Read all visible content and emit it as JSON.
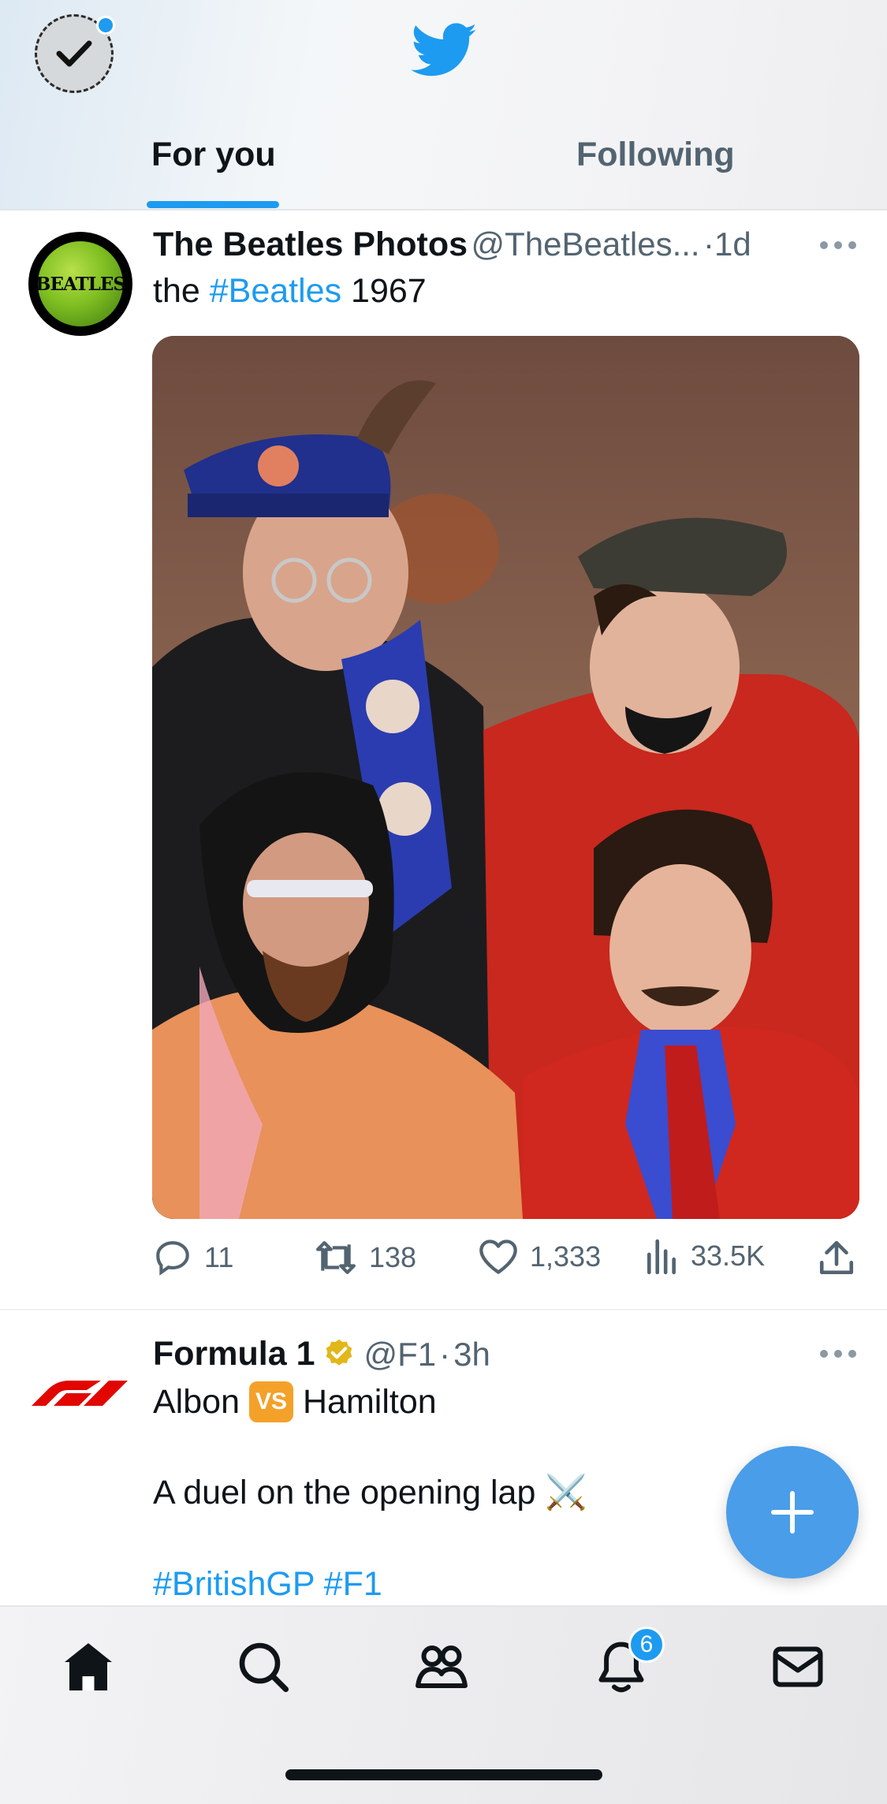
{
  "header": {
    "tabs": [
      {
        "label": "For you",
        "active": true
      },
      {
        "label": "Following",
        "active": false
      }
    ],
    "brand_icon": "twitter-bird-icon",
    "accent": "#1d9bf0"
  },
  "tweets": [
    {
      "name": "The Beatles Photos",
      "handle": "@TheBeatles...",
      "sep": "·",
      "time": "1d",
      "avatar_text": "BEATLES",
      "body": {
        "pre": "the ",
        "hashtag": "#Beatles",
        "post": " 1967"
      },
      "image_icon": "photo",
      "actions": {
        "replies": "11",
        "retweets": "138",
        "likes": "1,333",
        "views": "33.5K"
      }
    },
    {
      "name": "Formula 1",
      "verified": true,
      "handle": "@F1",
      "sep": "·",
      "time": "3h",
      "line1_a": "Albon",
      "vs": "VS",
      "line1_b": "Hamilton",
      "line2": "A duel on the opening lap ⚔️",
      "hashtags": "#BritishGP #F1"
    }
  ],
  "bottom_nav": {
    "items": [
      "home-icon",
      "search-icon",
      "communities-icon",
      "notifications-icon",
      "messages-icon"
    ],
    "notification_count": "6"
  }
}
